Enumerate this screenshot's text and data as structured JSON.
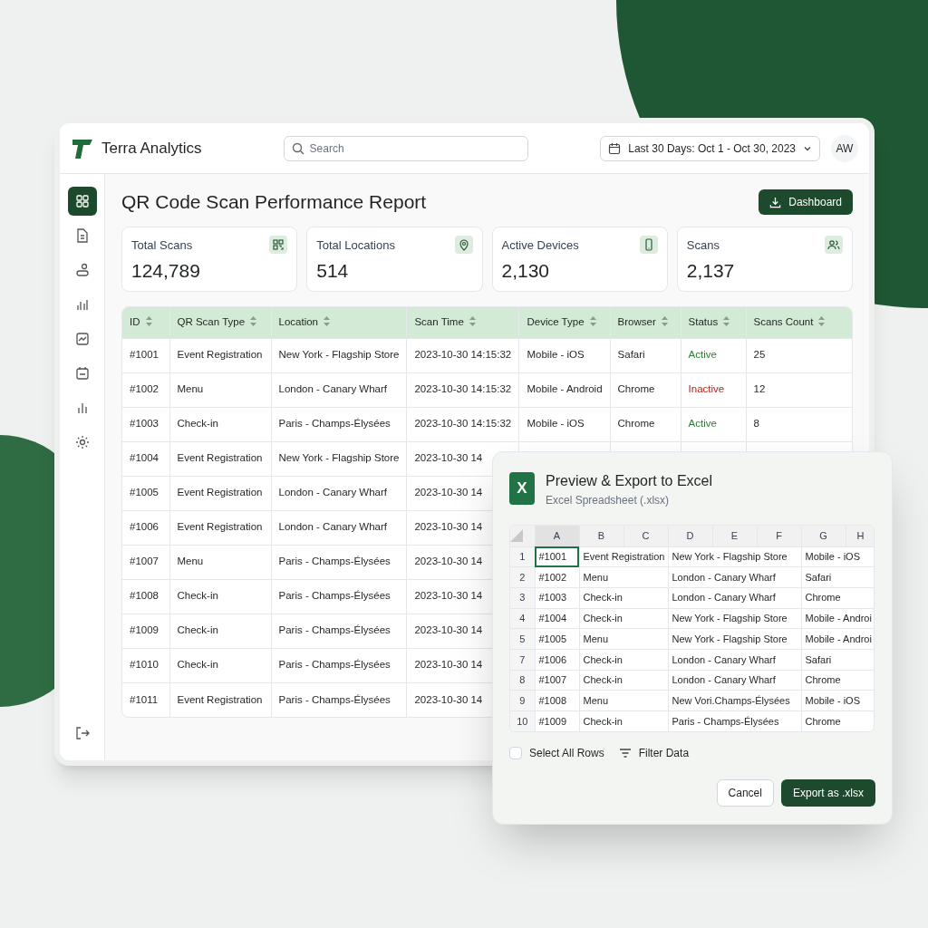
{
  "app": {
    "name": "Terra Analytics"
  },
  "search": {
    "placeholder": "Search"
  },
  "date_range": {
    "label": "Last 30 Days: Oct 1 - Oct 30, 2023"
  },
  "user": {
    "initials": "AW"
  },
  "sidebar": {
    "items": [
      {
        "selected": true
      },
      {
        "selected": false
      },
      {
        "selected": false
      },
      {
        "selected": false
      },
      {
        "selected": false
      },
      {
        "selected": false
      },
      {
        "selected": false
      },
      {
        "selected": false
      }
    ]
  },
  "page": {
    "title": "QR Code Scan Performance Report",
    "action": "Dashboard"
  },
  "stats": [
    {
      "label": "Total Scans",
      "value": "124,789"
    },
    {
      "label": "Total Locations",
      "value": "514"
    },
    {
      "label": "Active Devices",
      "value": "2,130"
    },
    {
      "label": "Scans",
      "value": "2,137"
    }
  ],
  "table": {
    "columns": [
      "ID",
      "QR Scan Type",
      "Location",
      "Scan Time",
      "Device Type",
      "Browser",
      "Status",
      "Scans Count"
    ],
    "rows": [
      {
        "cells": [
          "#1001",
          "Event Registration",
          "New York - Flagship Store",
          "2023-10-30 14:15:32",
          "Mobile - iOS",
          "Safari",
          "Active",
          "25"
        ],
        "color": "#2e7d32"
      },
      {
        "cells": [
          "#1002",
          "Menu",
          "London - Canary Wharf",
          "2023-10-30 14:15:32",
          "Mobile - Android",
          "Chrome",
          "Inactive",
          "12"
        ],
        "color": "#b3261e"
      },
      {
        "cells": [
          "#1003",
          "Check-in",
          "Paris - Champs-Élysées",
          "2023-10-30 14:15:32",
          "Mobile - iOS",
          "Chrome",
          "Active",
          "8"
        ],
        "color": "#2e7d32"
      },
      {
        "cells": [
          "#1004",
          "Event Registration",
          "New York - Flagship Store",
          "2023-10-30 14"
        ]
      },
      {
        "cells": [
          "#1005",
          "Event Registration",
          "London - Canary Wharf",
          "2023-10-30 14"
        ]
      },
      {
        "cells": [
          "#1006",
          "Event Registration",
          "London - Canary Wharf",
          "2023-10-30 14"
        ]
      },
      {
        "cells": [
          "#1007",
          "Menu",
          "Paris - Champs-Élysées",
          "2023-10-30 14"
        ]
      },
      {
        "cells": [
          "#1008",
          "Check-in",
          "Paris - Champs-Élysées",
          "2023-10-30 14"
        ]
      },
      {
        "cells": [
          "#1009",
          "Check-in",
          "Paris - Champs-Élysées",
          "2023-10-30 14"
        ]
      },
      {
        "cells": [
          "#1010",
          "Check-in",
          "Paris - Champs-Élysées",
          "2023-10-30 14"
        ]
      },
      {
        "cells": [
          "#1011",
          "Event Registration",
          "Paris - Champs-Élysées",
          "2023-10-30 14"
        ]
      }
    ]
  },
  "export_dialog": {
    "icon_letter": "X",
    "title": "Preview & Export to Excel",
    "subtitle": "Excel Spreadsheet (.xlsx)",
    "sheet": {
      "columns": [
        "A",
        "B",
        "C",
        "D",
        "E",
        "F",
        "G",
        "H"
      ],
      "rows": [
        {
          "label": "1",
          "id": "#1001",
          "type": "Event Registration",
          "location": "New York - Flagship Store",
          "device": "Mobile - iOS",
          "selected": true
        },
        {
          "label": "2",
          "id": "#1002",
          "type": "Menu",
          "location": "London - Canary Wharf",
          "device": "Safari",
          "selected": false
        },
        {
          "label": "3",
          "id": "#1003",
          "type": "Check-in",
          "location": "London - Canary Wharf",
          "device": "Chrome",
          "selected": false
        },
        {
          "label": "4",
          "id": "#1004",
          "type": "Check-in",
          "location": "New York - Flagship Store",
          "device": "Mobile - Androi",
          "selected": false
        },
        {
          "label": "5",
          "id": "#1005",
          "type": "Menu",
          "location": "New York - Flagship Store",
          "device": "Mobile - Androi",
          "selected": false
        },
        {
          "label": "7",
          "id": "#1006",
          "type": "Check-in",
          "location": "London - Canary Wharf",
          "device": "Safari",
          "selected": false
        },
        {
          "label": "8",
          "id": "#1007",
          "type": "Check-in",
          "location": "London - Canary Wharf",
          "device": "Chrome",
          "selected": false
        },
        {
          "label": "9",
          "id": "#1008",
          "type": "Menu",
          "location": "New Vori.Champs-Élysées",
          "device": "Mobile - iOS",
          "selected": false
        },
        {
          "label": "10",
          "id": "#1009",
          "type": "Check-in",
          "location": "Paris - Champs-Élysées",
          "device": "Chrome",
          "selected": false
        }
      ]
    },
    "select_all": {
      "label": "Select All Rows",
      "checked": false
    },
    "filter": "Filter Data",
    "buttons": {
      "cancel": "Cancel",
      "export": "Export as .xlsx"
    }
  }
}
